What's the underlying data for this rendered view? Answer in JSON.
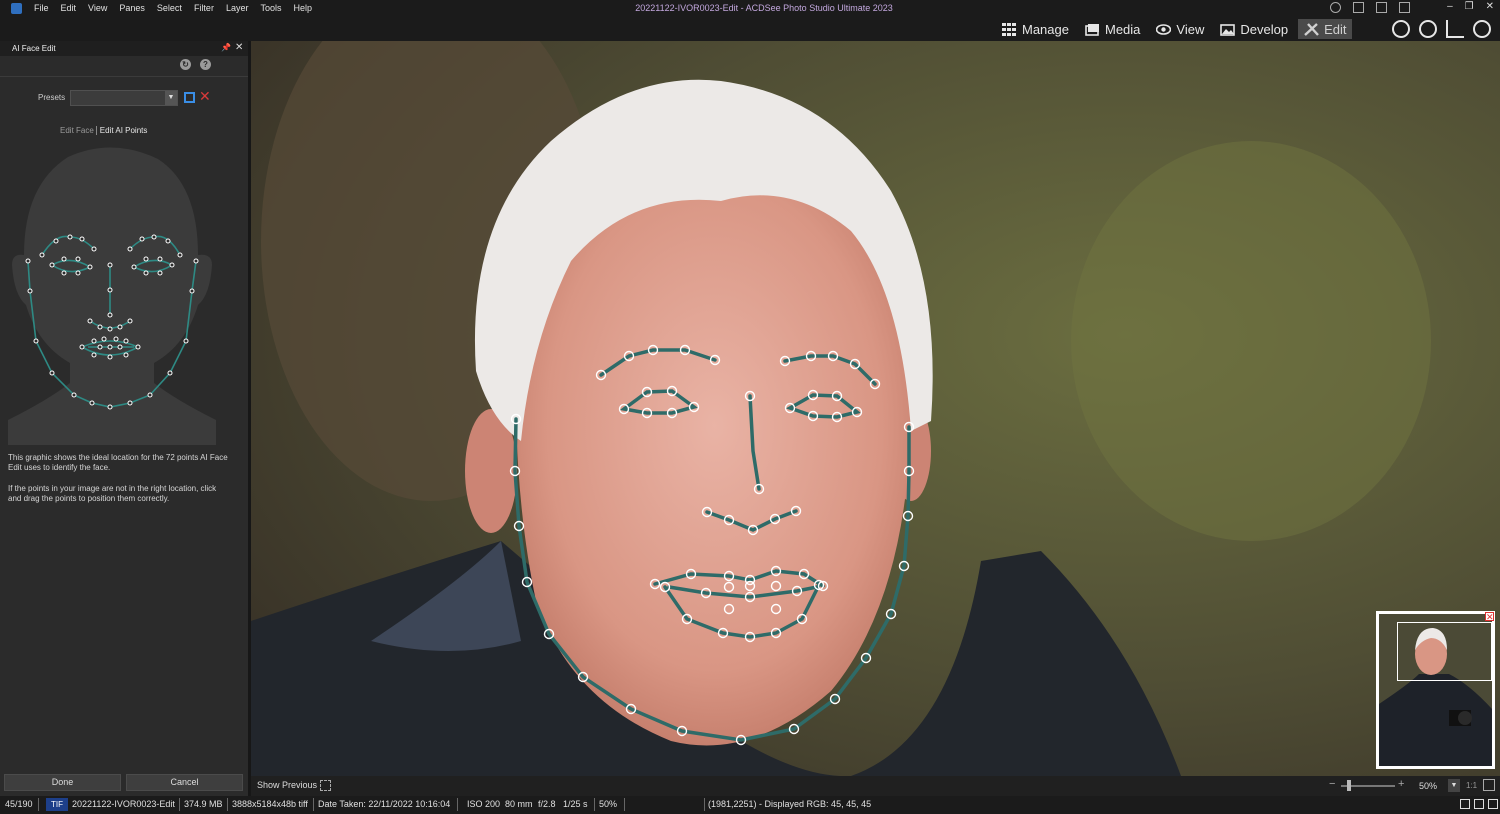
{
  "window": {
    "title": "20221122-IVOR0023-Edit - ACDSee Photo Studio Ultimate 2023",
    "menu": [
      "File",
      "Edit",
      "View",
      "Panes",
      "Select",
      "Filter",
      "Layer",
      "Tools",
      "Help"
    ]
  },
  "modes": [
    {
      "label": "Manage",
      "icon": "grid-icon"
    },
    {
      "label": "Media",
      "icon": "media-icon"
    },
    {
      "label": "View",
      "icon": "eye-icon"
    },
    {
      "label": "Develop",
      "icon": "develop-icon"
    },
    {
      "label": "Edit",
      "icon": "brush-icon",
      "active": true
    }
  ],
  "panel": {
    "title": "AI Face Edit",
    "presets_label": "Presets",
    "presets_value": "",
    "tabs": [
      "Edit Face",
      "Edit AI Points"
    ],
    "active_tab": "Edit AI Points",
    "help_text_1": "This graphic shows the ideal location for the 72 points AI Face Edit uses to identify the face.",
    "help_text_2": "If the points in your image are not in the right location, click and drag the points to position them correctly.",
    "done_label": "Done",
    "cancel_label": "Cancel"
  },
  "bottom_toolbar": {
    "show_previous": "Show Previous",
    "zoom_value": "50%",
    "zoom_one_to_one": "1:1"
  },
  "status": {
    "index": "45/190",
    "file_type": "TIF",
    "file_name": "20221122-IVOR0023-Edit",
    "file_size": "374.9 MB",
    "dimensions": "3888x5184x48b tiff",
    "date_taken": "Date Taken: 22/11/2022 10:16:04",
    "iso": "ISO 200",
    "focal": "80 mm",
    "aperture": "f/2.8",
    "shutter": "1/25 s",
    "zoom": "50%",
    "pixel_info": "(1981,2251) - Displayed RGB: 45, 45, 45"
  },
  "colors": {
    "landmark_line": "#2e6b68",
    "landmark_point": "#ffffff",
    "active_mode_bg": "#4a4a4a",
    "file_badge": "#1d3f8a",
    "delete_icon": "#d83a3a",
    "save_icon": "#3a8ee6"
  }
}
